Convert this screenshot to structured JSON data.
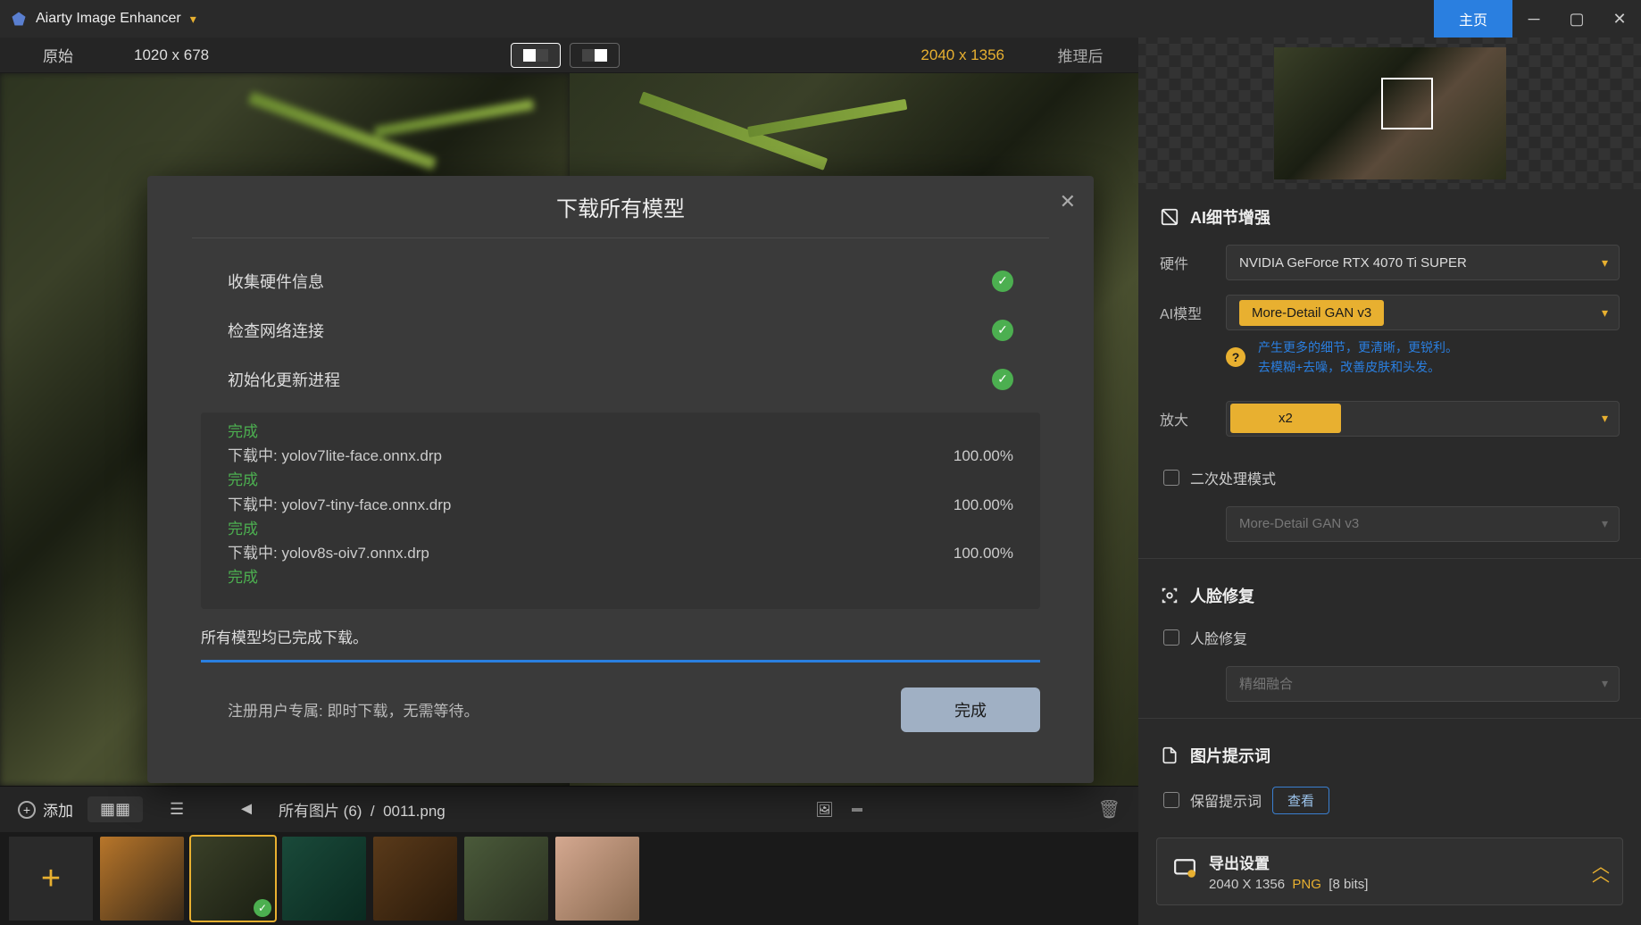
{
  "titlebar": {
    "app_name": "Aiarty Image Enhancer",
    "home": "主页"
  },
  "topinfo": {
    "original_label": "原始",
    "original_dims": "1020 x 678",
    "output_dims": "2040 x 1356",
    "after_label": "推理后"
  },
  "modal": {
    "title": "下载所有模型",
    "checks": [
      "收集硬件信息",
      "检查网络连接",
      "初始化更新进程"
    ],
    "log": [
      {
        "done": "完成"
      },
      {
        "txt": "下载中: yolov7lite-face.onnx.drp",
        "pct": "100.00%"
      },
      {
        "done": "完成"
      },
      {
        "txt": "下载中: yolov7-tiny-face.onnx.drp",
        "pct": "100.00%"
      },
      {
        "done": "完成"
      },
      {
        "txt": "下载中: yolov8s-oiv7.onnx.drp",
        "pct": "100.00%"
      },
      {
        "done": "完成"
      }
    ],
    "all_complete": "所有模型均已完成下载。",
    "reg_note": "注册用户专属: 即时下载，无需等待。",
    "done_btn": "完成"
  },
  "footbar": {
    "add": "添加",
    "breadcrumb_all": "所有图片 (6)",
    "current_file": "0011.png"
  },
  "sidebar": {
    "ai_detail_hdr": "AI细节增强",
    "hardware_lbl": "硬件",
    "hardware_val": "NVIDIA GeForce RTX 4070 Ti SUPER",
    "model_lbl": "AI模型",
    "model_val": "More-Detail GAN  v3",
    "model_hint1": "产生更多的细节，更清晰，更锐利。",
    "model_hint2": "去模糊+去噪，改善皮肤和头发。",
    "scale_lbl": "放大",
    "scale_val": "x2",
    "secondary_lbl": "二次处理模式",
    "secondary_val": "More-Detail GAN  v3",
    "face_hdr": "人脸修复",
    "face_chk": "人脸修复",
    "face_mode": "精细融合",
    "prompt_hdr": "图片提示词",
    "keep_prompt": "保留提示词",
    "view_btn": "查看",
    "export_hdr": "导出设置",
    "export_dims": "2040 X 1356",
    "export_fmt": "PNG",
    "export_bits": "[8 bits]"
  }
}
